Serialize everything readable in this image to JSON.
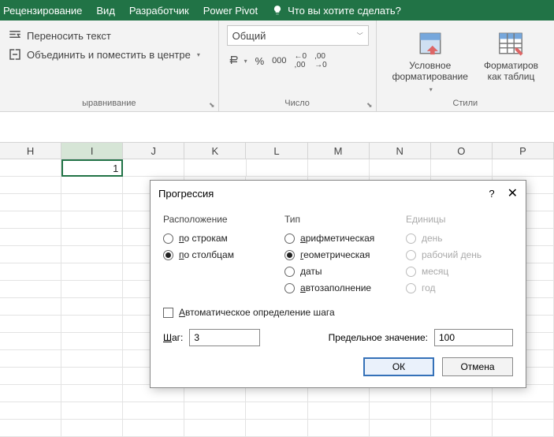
{
  "menubar": {
    "items": [
      "Рецензирование",
      "Вид",
      "Разработчик",
      "Power Pivot"
    ],
    "tell_me": "Что вы хотите сделать?"
  },
  "ribbon": {
    "alignment": {
      "wrap_text": "Переносить текст",
      "merge_center": "Объединить и поместить в центре",
      "group_label": "ыравнивание"
    },
    "number": {
      "format_selected": "Общий",
      "group_label": "Число"
    },
    "styles": {
      "cond_fmt": "Условное\nформатирование",
      "as_table": "Форматиров\nкак таблиц",
      "group_label": "Стили"
    }
  },
  "sheet": {
    "columns": [
      "H",
      "I",
      "J",
      "K",
      "L",
      "M",
      "N",
      "O",
      "P"
    ],
    "active_index": 1,
    "active_value": "1"
  },
  "dialog": {
    "title": "Прогрессия",
    "help": "?",
    "groups": {
      "layout": {
        "title": "Расположение",
        "options": [
          "по строкам",
          "по столбцам"
        ],
        "selected": 1
      },
      "type": {
        "title": "Тип",
        "options": [
          "арифметическая",
          "геометрическая",
          "даты",
          "автозаполнение"
        ],
        "selected": 1
      },
      "units": {
        "title": "Единицы",
        "options": [
          "день",
          "рабочий день",
          "месяц",
          "год"
        ],
        "disabled": true
      }
    },
    "auto_step": "Автоматическое определение шага",
    "step_label": "Шаг:",
    "step_value": "3",
    "limit_label": "Предельное значение:",
    "limit_value": "100",
    "ok": "ОК",
    "cancel": "Отмена"
  }
}
